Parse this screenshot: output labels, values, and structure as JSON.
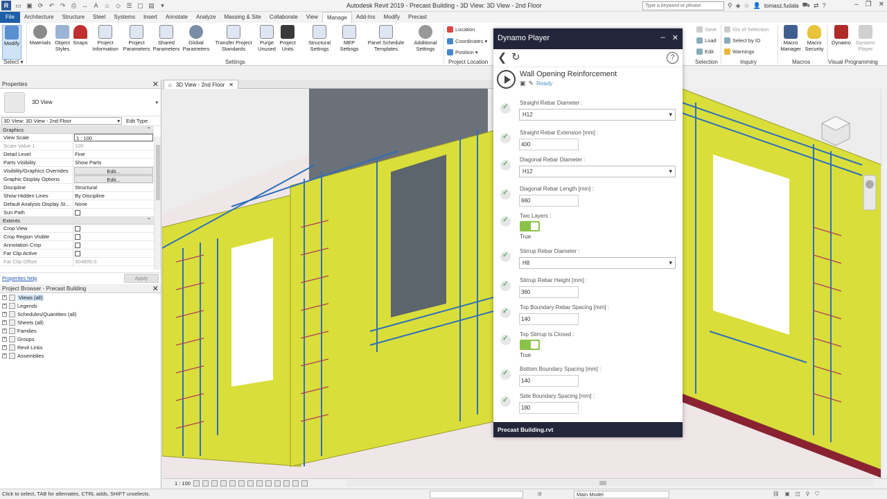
{
  "app": {
    "title": "Autodesk Revit 2019 - Precast Building - 3D View: 3D View - 2nd Floor",
    "search_placeholder": "Type a keyword or phrase",
    "user": "tomasz.fudala"
  },
  "tabs": [
    "File",
    "Architecture",
    "Structure",
    "Steel",
    "Systems",
    "Insert",
    "Annotate",
    "Analyze",
    "Massing & Site",
    "Collaborate",
    "View",
    "Manage",
    "Add-Ins",
    "Modify",
    "Precast"
  ],
  "active_tab": "Manage",
  "ribbon": {
    "modify": "Modify",
    "select_group": "Select ▾",
    "materials": "Materials",
    "object_styles": "Object Styles",
    "snaps": "Snaps",
    "project_information": "Project Information",
    "project_parameters": "Project Parameters",
    "shared_parameters": "Shared Parameters",
    "global_parameters": "Global Parameters",
    "transfer_standards": "Transfer Project Standards",
    "purge_unused": "Purge Unused",
    "project_units": "Project Units",
    "structural_settings": "Structural Settings",
    "mep_settings": "MEP Settings",
    "panel_schedule_templates": "Panel Schedule Templates",
    "additional_settings": "Additional Settings",
    "settings_group": "Settings",
    "location": "Location",
    "coordinates": "Coordinates ▾",
    "position": "Position ▾",
    "project_location_group": "Project Location",
    "save": "Save",
    "load": "Load",
    "edit": "Edit",
    "selection_group": "Selection",
    "ids_of_selection": "IDs of Selection",
    "select_by_id": "Select by ID",
    "warnings": "Warnings",
    "inquiry_group": "Inquiry",
    "macro_manager": "Macro Manager",
    "macro_security": "Macro Security",
    "macros_group": "Macros",
    "dynamo": "Dynamo",
    "dynamo_player": "Dynamo Player",
    "visual_programming_group": "Visual Programming"
  },
  "properties": {
    "title": "Properties",
    "type": "3D View",
    "instance": "3D View: 3D View - 2nd Floor",
    "edit_type": "Edit Type",
    "groups": [
      {
        "name": "Graphics",
        "rows": [
          {
            "name": "View Scale",
            "value": "1 : 100",
            "style": "boxed"
          },
          {
            "name": "Scale Value    1:",
            "value": "100",
            "style": "grey"
          },
          {
            "name": "Detail Level",
            "value": "Fine"
          },
          {
            "name": "Parts Visibility",
            "value": "Show Parts"
          },
          {
            "name": "Visibility/Graphics Overrides",
            "value": "Edit...",
            "style": "btn"
          },
          {
            "name": "Graphic Display Options",
            "value": "Edit...",
            "style": "btn"
          },
          {
            "name": "Discipline",
            "value": "Structural"
          },
          {
            "name": "Show Hidden Lines",
            "value": "By Discipline"
          },
          {
            "name": "Default Analysis Display St...",
            "value": "None"
          },
          {
            "name": "Sun Path",
            "value": "",
            "style": "check"
          }
        ]
      },
      {
        "name": "Extents",
        "rows": [
          {
            "name": "Crop View",
            "value": "",
            "style": "check"
          },
          {
            "name": "Crop Region Visible",
            "value": "",
            "style": "check"
          },
          {
            "name": "Annotation Crop",
            "value": "",
            "style": "check"
          },
          {
            "name": "Far Clip Active",
            "value": "",
            "style": "check"
          },
          {
            "name": "Far Clip Offset",
            "value": "304800.0",
            "style": "grey"
          }
        ]
      }
    ],
    "help_link": "Properties help",
    "apply": "Apply"
  },
  "project_browser": {
    "title": "Project Browser - Precast Building",
    "items": [
      "Views (all)",
      "Legends",
      "Schedules/Quantities (all)",
      "Sheets (all)",
      "Families",
      "Groups",
      "Revit Links",
      "Assemblies"
    ]
  },
  "view_tab": "3D View - 2nd Floor",
  "view_bar": {
    "scale": "1 : 100"
  },
  "status": {
    "hint": "Click to select, TAB for alternates, CTRL adds, SHIFT unselects.",
    "zero": ":0",
    "model": "Main Model"
  },
  "dynamo_player": {
    "title": "Dynamo Player",
    "script_name": "Wall Opening Reinforcement",
    "script_status": "Ready",
    "params": [
      {
        "label": "Straight Rebar Diameter :",
        "type": "select",
        "value": "H12"
      },
      {
        "label": "Straight Rebar Extension [mm] :",
        "type": "input",
        "value": "400"
      },
      {
        "label": "Diagonal Rebar Diameter :",
        "type": "select",
        "value": "H12"
      },
      {
        "label": "Diagonal Rebar Length [mm] :",
        "type": "input",
        "value": "660"
      },
      {
        "label": "Two Layers :",
        "type": "toggle",
        "value": "True"
      },
      {
        "label": "Stirrup Rebar Diameter :",
        "type": "select",
        "value": "H8"
      },
      {
        "label": "Stirrup Rebar Height [mm] :",
        "type": "input",
        "value": "360"
      },
      {
        "label": "Top Boundary Rebar Spacing [mm] :",
        "type": "input",
        "value": "140"
      },
      {
        "label": "Top Stirrup Is Closed :",
        "type": "toggle",
        "value": "True"
      },
      {
        "label": "Bottom Boundary Spacing [mm] :",
        "type": "input",
        "value": "140"
      },
      {
        "label": "Side Boundary Spacing [mm] :",
        "type": "input",
        "value": "180"
      }
    ],
    "footer": "Precast Building.rvt"
  },
  "colors": {
    "wall": "#d9de3a",
    "rebar_blue": "#2e6fb8",
    "rebar_red": "#b03a5a",
    "dynamo_header": "#23263a",
    "toggle_on": "#8bc34a",
    "file_tab": "#1f5fa8"
  }
}
